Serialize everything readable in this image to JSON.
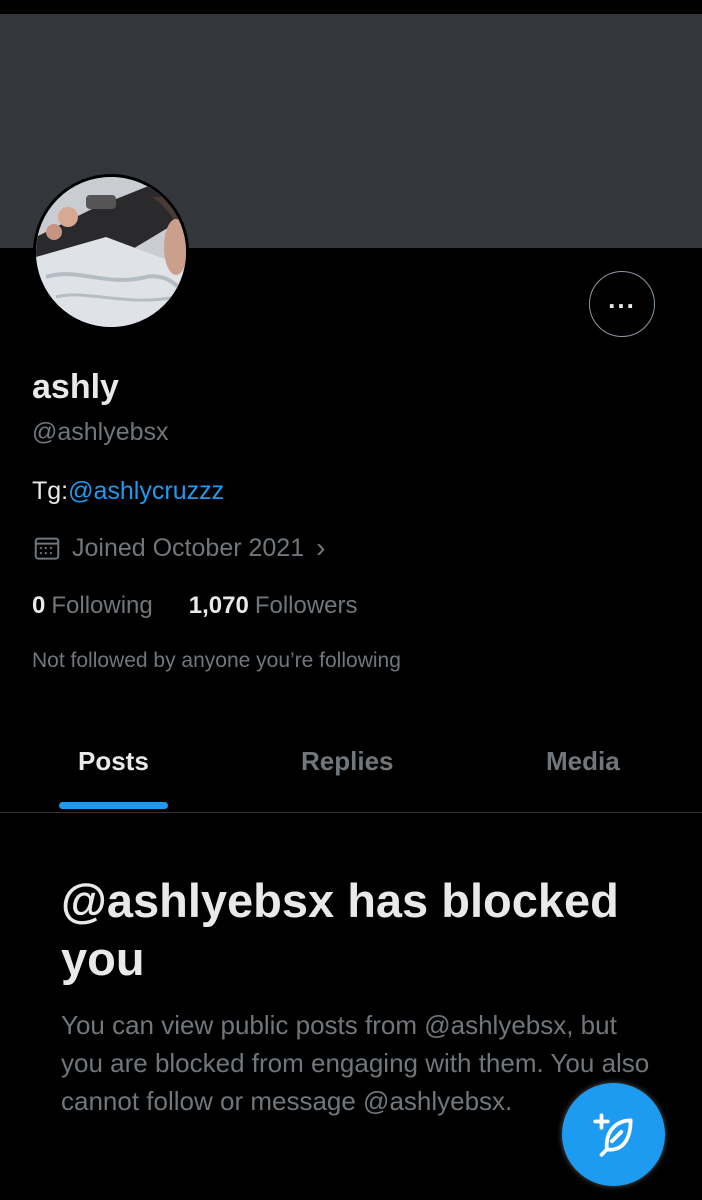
{
  "profile": {
    "name": "ashly",
    "handle": "@ashlyebsx",
    "bio_prefix": "Tg:",
    "bio_mention": "@ashlycruzzz",
    "joined": "Joined October 2021",
    "following_count": "0",
    "following_label": "Following",
    "followers_count": "1,070",
    "followers_label": "Followers",
    "not_followed_text": "Not followed by anyone you’re following"
  },
  "tabs": [
    {
      "label": "Posts",
      "active": true
    },
    {
      "label": "Replies",
      "active": false
    },
    {
      "label": "Media",
      "active": false
    }
  ],
  "blocked": {
    "title": "@ashlyebsx has blocked you",
    "message": "You can view public posts from @ashlyebsx, but you are blocked from engaging with them. You also cannot follow or message @ashlyebsx."
  },
  "icons": {
    "more": "more-horizontal-icon",
    "calendar": "calendar-icon",
    "chevron": "chevron-right-icon",
    "compose": "compose-post-icon"
  },
  "colors": {
    "background": "#000000",
    "banner": "#33363a",
    "accent": "#1d9bf0",
    "text_primary": "#e7e9ea",
    "text_secondary": "#71767b"
  }
}
